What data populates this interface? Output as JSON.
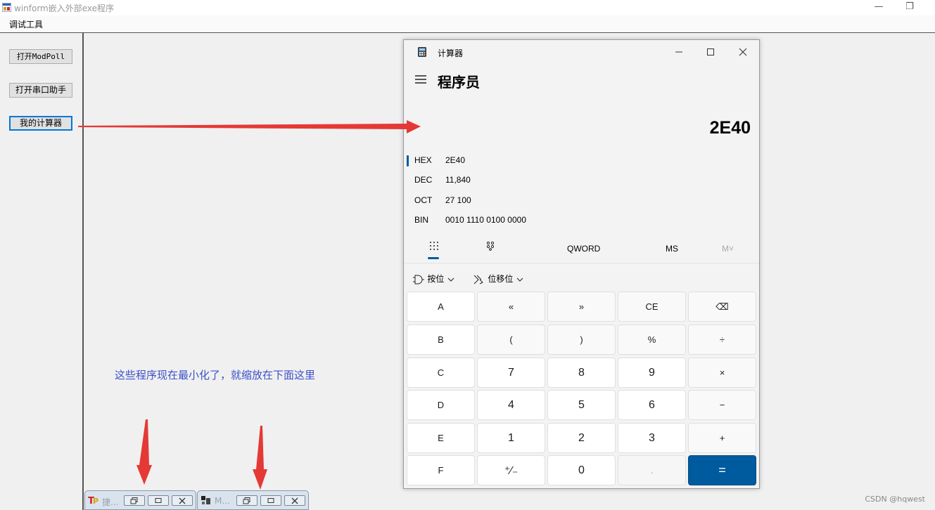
{
  "window": {
    "title": "winform嵌入外部exe程序",
    "icon": "winform-app-icon",
    "restore_glyph": "❐",
    "minimize_glyph": "—"
  },
  "menu": {
    "debug_tools": "调试工具"
  },
  "sidebar": {
    "buttons": [
      {
        "label": "打开ModPoll"
      },
      {
        "label": "打开串口助手"
      },
      {
        "label": "我的计算器"
      }
    ]
  },
  "annotation": {
    "text": "这些程序现在最小化了，就缩放在下面这里",
    "arrow_color": "#e53935",
    "text_color": "#3a50c8"
  },
  "minimized_windows": [
    {
      "title": "捷...",
      "icon": "tp-app-icon"
    },
    {
      "title": "M...",
      "icon": "modpoll-app-icon"
    }
  ],
  "calculator": {
    "title": "计算器",
    "mode": "程序员",
    "display": "2E40",
    "bases": [
      {
        "label": "HEX",
        "value": "2E40"
      },
      {
        "label": "DEC",
        "value": "11,840"
      },
      {
        "label": "OCT",
        "value": "27 100"
      },
      {
        "label": "BIN",
        "value": "0010 1110 0100 0000"
      }
    ],
    "tabs": {
      "word_size": "QWORD",
      "memory_store": "MS",
      "memory_list": "M˅"
    },
    "operators": {
      "bitwise": "按位",
      "bit_shift": "位移位"
    },
    "keys": [
      [
        "A",
        "«",
        "»",
        "CE",
        "⌫"
      ],
      [
        "B",
        "(",
        ")",
        "%",
        "÷"
      ],
      [
        "C",
        "7",
        "8",
        "9",
        "×"
      ],
      [
        "D",
        "4",
        "5",
        "6",
        "−"
      ],
      [
        "E",
        "1",
        "2",
        "3",
        "+"
      ],
      [
        "F",
        "⁺∕₋",
        "0",
        ".",
        "="
      ]
    ],
    "accent_color": "#005a9e"
  },
  "watermark": "CSDN @hqwest"
}
